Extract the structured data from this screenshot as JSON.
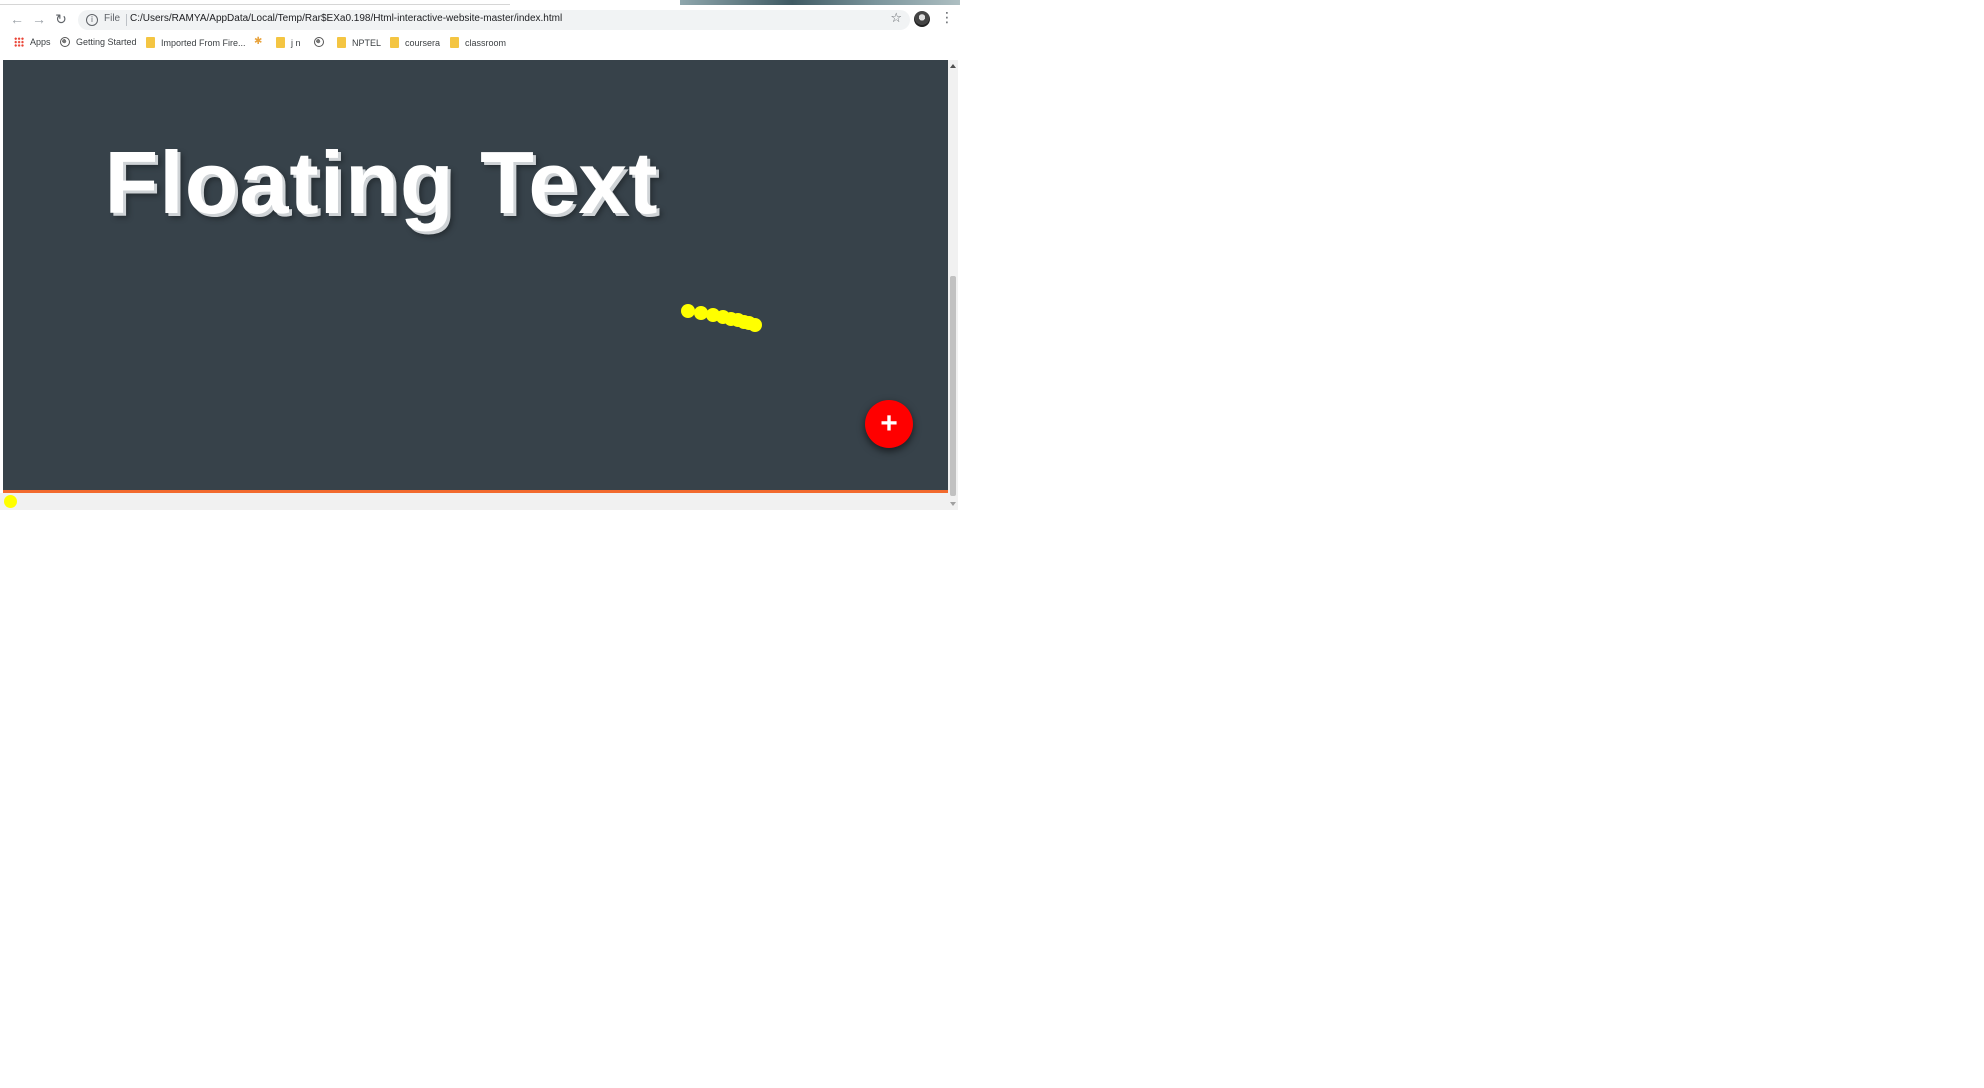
{
  "browser": {
    "file_label": "File",
    "url": "C:/Users/RAMYA/AppData/Local/Temp/Rar$EXa0.198/Html-interactive-website-master/index.html",
    "bookmarks": [
      {
        "label": "Apps",
        "icon": "apps-grid-icon"
      },
      {
        "label": "Getting Started",
        "icon": "globe-icon"
      },
      {
        "label": "Imported From Fire...",
        "icon": "folder-icon"
      },
      {
        "label": "",
        "icon": "bookmark-star-icon"
      },
      {
        "label": "j n",
        "icon": "folder-icon"
      },
      {
        "label": "",
        "icon": "globe-icon"
      },
      {
        "label": "NPTEL",
        "icon": "folder-icon"
      },
      {
        "label": "coursera",
        "icon": "folder-icon"
      },
      {
        "label": "classroom",
        "icon": "folder-icon"
      }
    ]
  },
  "page": {
    "headline": "Floating Text",
    "fab_label": "+",
    "background_color": "#37424a",
    "fab_color": "#ff0000",
    "trail_color": "#ffff00",
    "accent_line_color": "#f26a2e"
  }
}
